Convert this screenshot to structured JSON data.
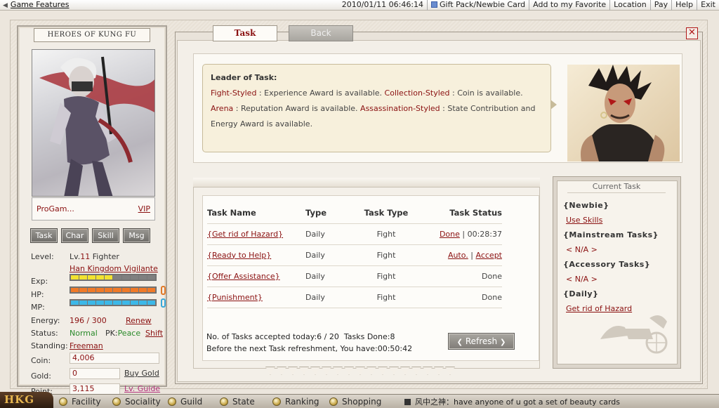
{
  "topbar": {
    "game_features": "Game Features",
    "datetime": "2010/01/11 06:46:14",
    "links": [
      "Gift Pack/Newbie Card",
      "Add to my Favorite",
      "Location",
      "Pay",
      "Help",
      "Exit"
    ]
  },
  "left": {
    "title": "HEROES OF KUNG FU",
    "player_name": "ProGam...",
    "vip": "VIP",
    "tabs": [
      "Task",
      "Char",
      "Skill",
      "Msg"
    ],
    "level_label": "Level:",
    "level_prefix": "Lv.",
    "level_num": "11",
    "level_class": "Fighter",
    "title_link": "Han Kingdom Vigilante",
    "exp_label": "Exp:",
    "exp_fill": 0.45,
    "hp_label": "HP:",
    "hp_fill": 1.0,
    "mp_label": "MP:",
    "mp_fill": 1.0,
    "energy_label": "Energy:",
    "energy_value": "196 / 300",
    "renew": "Renew",
    "status_label": "Status:",
    "status_value": "Normal",
    "pk_label": "PK:",
    "pk_value": "Peace",
    "shift": "Shift",
    "standing_label": "Standing:",
    "standing_value": "Freeman",
    "coin_label": "Coin:",
    "coin_value": "4,006",
    "gold_label": "Gold:",
    "gold_value": "0",
    "buy_gold": "Buy Gold",
    "point_label": "Point:",
    "point_value": "3,115",
    "lv_guide": "Lv. Guide",
    "colors": {
      "exp": "#f2e230",
      "hp": "#f07a28",
      "mp": "#3cb8e8"
    }
  },
  "main": {
    "tab_task": "Task",
    "tab_back": "Back",
    "close": "✕",
    "leader": {
      "title": "Leader of Task:",
      "k1": "Fight-Styled",
      "t1": " : Experience Award is available. ",
      "k2": "Collection-Styled",
      "t2": " : Coin is available. ",
      "k3": "Arena",
      "t3": " : Reputation Award is available. ",
      "k4": "Assassination-Styled",
      "t4": " : State Contribution and Energy Award is available."
    },
    "table": {
      "headers": [
        "Task Name",
        "Type",
        "Task Type",
        "Task Status"
      ],
      "rows": [
        {
          "name": "{Get rid of Hazard}",
          "type": "Daily",
          "task_type": "Fight",
          "status_link": "Done",
          "status_extra": "| 00:28:37"
        },
        {
          "name": "{Ready to Help}",
          "type": "Daily",
          "task_type": "Fight",
          "status_link": "Auto.",
          "status_extra": "|",
          "status_link2": "Accept"
        },
        {
          "name": "{Offer Assistance}",
          "type": "Daily",
          "task_type": "Fight",
          "status_done": "Done"
        },
        {
          "name": "{Punishment}",
          "type": "Daily",
          "task_type": "Fight",
          "status_done": "Done"
        }
      ]
    },
    "summary_line1_a": "No. of Tasks accepted today:",
    "summary_accepted": "6 / 20",
    "summary_line1_b": "Tasks Done:",
    "summary_done": "8",
    "summary_line2_a": "Before the next Task refreshment, You have:",
    "summary_time": "00:50:42",
    "refresh": "Refresh"
  },
  "current_task": {
    "header": "Current Task",
    "newbie": "{Newbie}",
    "newbie_item": "Use Skills",
    "mainstream": "{Mainstream Tasks}",
    "mainstream_item": "< N/A >",
    "accessory": "{Accessory Tasks}",
    "accessory_item": "< N/A >",
    "daily": "{Daily}",
    "daily_item": "Get rid of Hazard"
  },
  "bottom": {
    "logo": "HKG",
    "menu": [
      "Facility",
      "Sociality",
      "Guild",
      "State",
      "Ranking",
      "Shopping"
    ],
    "chat_speaker": "风中之神：",
    "chat_text": "have anyone of u got a set of beauty cards"
  }
}
